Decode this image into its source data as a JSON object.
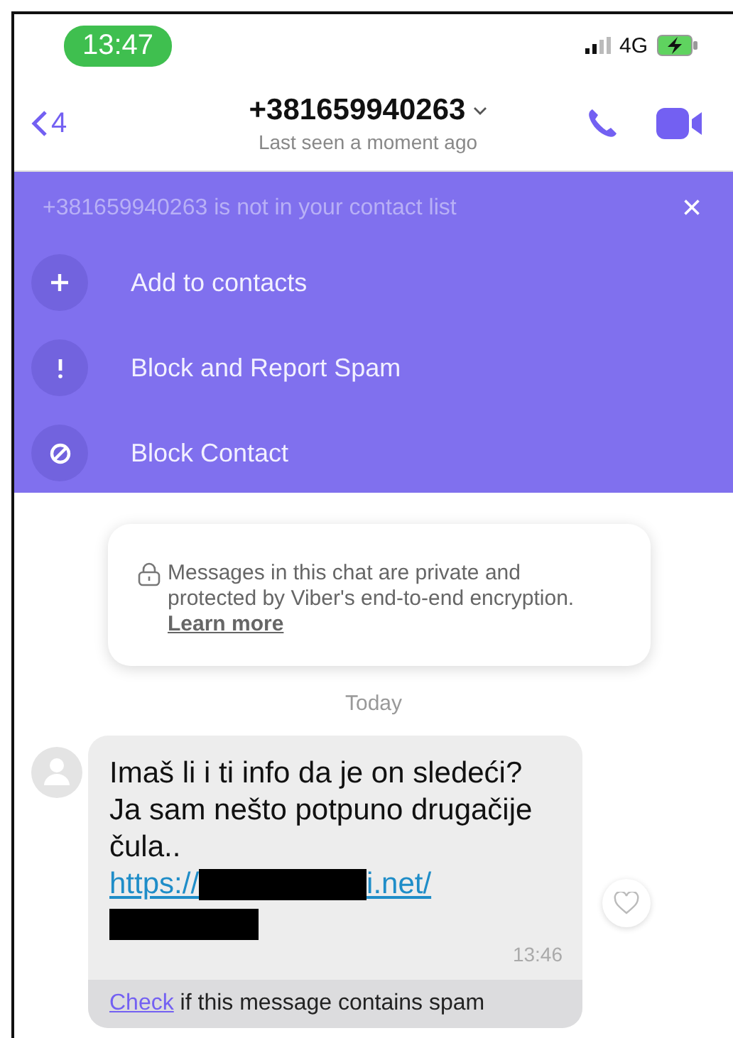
{
  "status_bar": {
    "time": "13:47",
    "network": "4G"
  },
  "header": {
    "back_count": "4",
    "title": "+381659940263",
    "subtitle": "Last seen a moment ago"
  },
  "banner": {
    "notice": "+381659940263 is not in your contact list",
    "close": "×",
    "actions": [
      {
        "kind": "add",
        "label": "Add to contacts"
      },
      {
        "kind": "report",
        "label": "Block and Report Spam"
      },
      {
        "kind": "block",
        "label": "Block Contact"
      }
    ]
  },
  "encryption_notice": {
    "text": "Messages in this chat are private and protected by Viber's end-to-end encryption.",
    "link": "Learn more"
  },
  "date_divider": "Today",
  "message": {
    "text": "Imaš li i ti info da je on sledeći? Ja sam nešto potpuno drugačije čula..",
    "link_start": "https://",
    "link_end": "i.net/",
    "time": "13:46",
    "liked": false,
    "spam_link": "Check",
    "spam_text": "if this message contains spam"
  }
}
